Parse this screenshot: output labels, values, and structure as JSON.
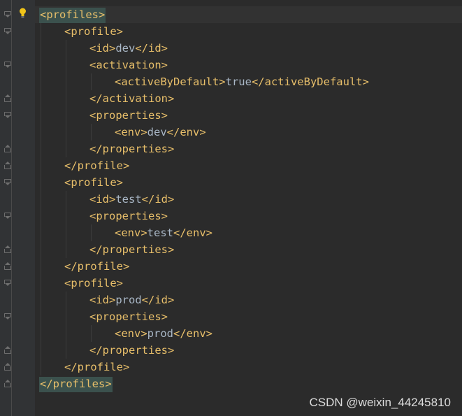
{
  "editor": {
    "lines": [
      {
        "parts": [
          {
            "t": "<profiles>",
            "c": "tag hl"
          }
        ]
      },
      {
        "parts": [
          {
            "t": "<profile>",
            "c": "tag"
          }
        ]
      },
      {
        "parts": [
          {
            "t": "<id>",
            "c": "tag"
          },
          {
            "t": "dev",
            "c": "val"
          },
          {
            "t": "</id>",
            "c": "tag"
          }
        ]
      },
      {
        "parts": [
          {
            "t": "<activation>",
            "c": "tag"
          }
        ]
      },
      {
        "parts": [
          {
            "t": "<activeByDefault>",
            "c": "tag"
          },
          {
            "t": "true",
            "c": "val"
          },
          {
            "t": "</activeByDefault>",
            "c": "tag"
          }
        ]
      },
      {
        "parts": [
          {
            "t": "</activation>",
            "c": "tag"
          }
        ]
      },
      {
        "parts": [
          {
            "t": "<properties>",
            "c": "tag"
          }
        ]
      },
      {
        "parts": [
          {
            "t": "<env>",
            "c": "tag"
          },
          {
            "t": "dev",
            "c": "val"
          },
          {
            "t": "</env>",
            "c": "tag"
          }
        ]
      },
      {
        "parts": [
          {
            "t": "</properties>",
            "c": "tag"
          }
        ]
      },
      {
        "parts": [
          {
            "t": "</profile>",
            "c": "tag"
          }
        ]
      },
      {
        "parts": [
          {
            "t": "<profile>",
            "c": "tag"
          }
        ]
      },
      {
        "parts": [
          {
            "t": "<id>",
            "c": "tag"
          },
          {
            "t": "test",
            "c": "val"
          },
          {
            "t": "</id>",
            "c": "tag"
          }
        ]
      },
      {
        "parts": [
          {
            "t": "<properties>",
            "c": "tag"
          }
        ]
      },
      {
        "parts": [
          {
            "t": "<env>",
            "c": "tag"
          },
          {
            "t": "test",
            "c": "val"
          },
          {
            "t": "</env>",
            "c": "tag"
          }
        ]
      },
      {
        "parts": [
          {
            "t": "</properties>",
            "c": "tag"
          }
        ]
      },
      {
        "parts": [
          {
            "t": "</profile>",
            "c": "tag"
          }
        ]
      },
      {
        "parts": [
          {
            "t": "<profile>",
            "c": "tag"
          }
        ]
      },
      {
        "parts": [
          {
            "t": "<id>",
            "c": "tag"
          },
          {
            "t": "prod",
            "c": "val"
          },
          {
            "t": "</id>",
            "c": "tag"
          }
        ]
      },
      {
        "parts": [
          {
            "t": "<properties>",
            "c": "tag"
          }
        ]
      },
      {
        "parts": [
          {
            "t": "<env>",
            "c": "tag"
          },
          {
            "t": "prod",
            "c": "val"
          },
          {
            "t": "</env>",
            "c": "tag"
          }
        ]
      },
      {
        "parts": [
          {
            "t": "</properties>",
            "c": "tag"
          }
        ]
      },
      {
        "parts": [
          {
            "t": "</profile>",
            "c": "tag"
          }
        ]
      },
      {
        "parts": [
          {
            "t": "</profiles>",
            "c": "tag hl"
          }
        ]
      }
    ]
  },
  "gutter": {
    "bulb_icon": "lightbulb-icon",
    "fold_icon": "fold-marker-icon"
  },
  "colors": {
    "background": "#2b2b2b",
    "tag": "#e8bf6a",
    "value": "#a9b7c6",
    "match_highlight": "#3b514d"
  },
  "watermark": "CSDN @weixin_44245810"
}
